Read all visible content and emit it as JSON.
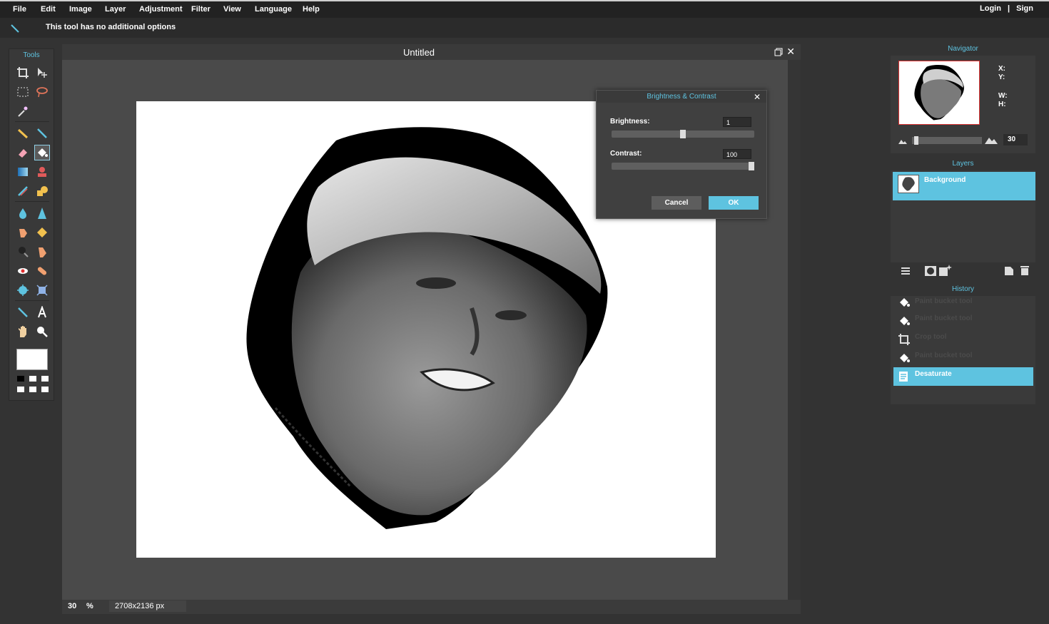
{
  "menu": {
    "items": [
      "File",
      "Edit",
      "Image",
      "Layer",
      "Adjustment",
      "Filter",
      "View",
      "Language",
      "Help"
    ],
    "login": "Login",
    "separator": "|",
    "sign": "Sign"
  },
  "options_bar": {
    "message": "This tool has no additional options"
  },
  "tools_panel": {
    "title": "Tools"
  },
  "document": {
    "title": "Untitled",
    "zoom": "30",
    "zoom_unit": "%",
    "dimensions": "2708x2136 px"
  },
  "dialog": {
    "title": "Brightness & Contrast",
    "brightness_label": "Brightness:",
    "brightness_value": "1",
    "brightness_fraction": 0.5,
    "contrast_label": "Contrast:",
    "contrast_value": "100",
    "contrast_fraction": 1.0,
    "cancel": "Cancel",
    "ok": "OK"
  },
  "navigator": {
    "title": "Navigator",
    "x_label": "X:",
    "y_label": "Y:",
    "w_label": "W:",
    "h_label": "H:",
    "zoom_value": "30",
    "zoom_fraction": 0.03
  },
  "layers": {
    "title": "Layers",
    "items": [
      {
        "name": "Background"
      }
    ]
  },
  "history": {
    "title": "History",
    "items": [
      {
        "name": "Paint bucket tool",
        "icon": "paint-bucket-icon"
      },
      {
        "name": "Paint bucket tool",
        "icon": "paint-bucket-icon"
      },
      {
        "name": "Crop tool",
        "icon": "crop-icon"
      },
      {
        "name": "Paint bucket tool",
        "icon": "paint-bucket-icon"
      },
      {
        "name": "Desaturate",
        "icon": "desaturate-icon",
        "active": true
      }
    ]
  },
  "colors": {
    "accent": "#5ec3e0",
    "panel": "#3a3a3a",
    "canvas_bg": "#4a4a4a"
  }
}
